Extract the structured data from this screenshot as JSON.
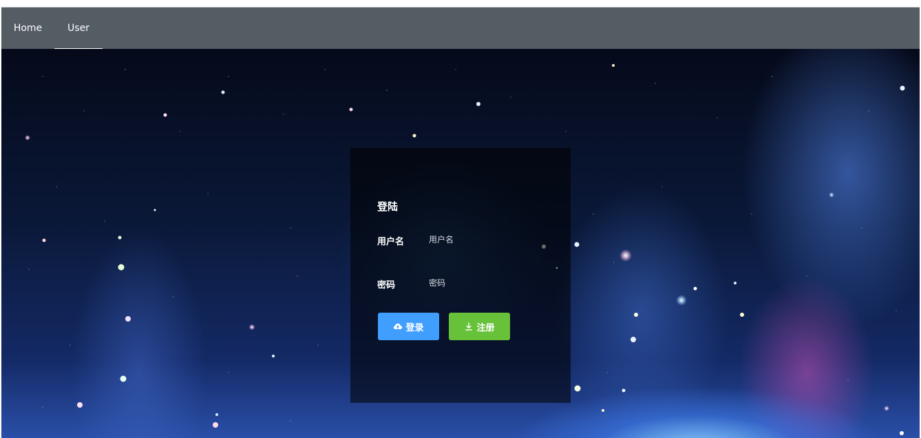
{
  "nav": {
    "items": [
      {
        "label": "Home",
        "active": false
      },
      {
        "label": "User",
        "active": true
      }
    ],
    "background_color": "#545c64",
    "active_indicator_color": "#ffffff"
  },
  "login": {
    "title": "登陆",
    "username": {
      "label": "用户名",
      "placeholder": "用户名",
      "value": ""
    },
    "password": {
      "label": "密码",
      "placeholder": "密码",
      "value": ""
    },
    "login_button": {
      "label": "登录",
      "icon": "cloud-upload-icon",
      "color": "#409eff"
    },
    "register_button": {
      "label": "注册",
      "icon": "download-icon",
      "color": "#67c23a"
    }
  },
  "background": {
    "theme": "starry-galaxy"
  }
}
